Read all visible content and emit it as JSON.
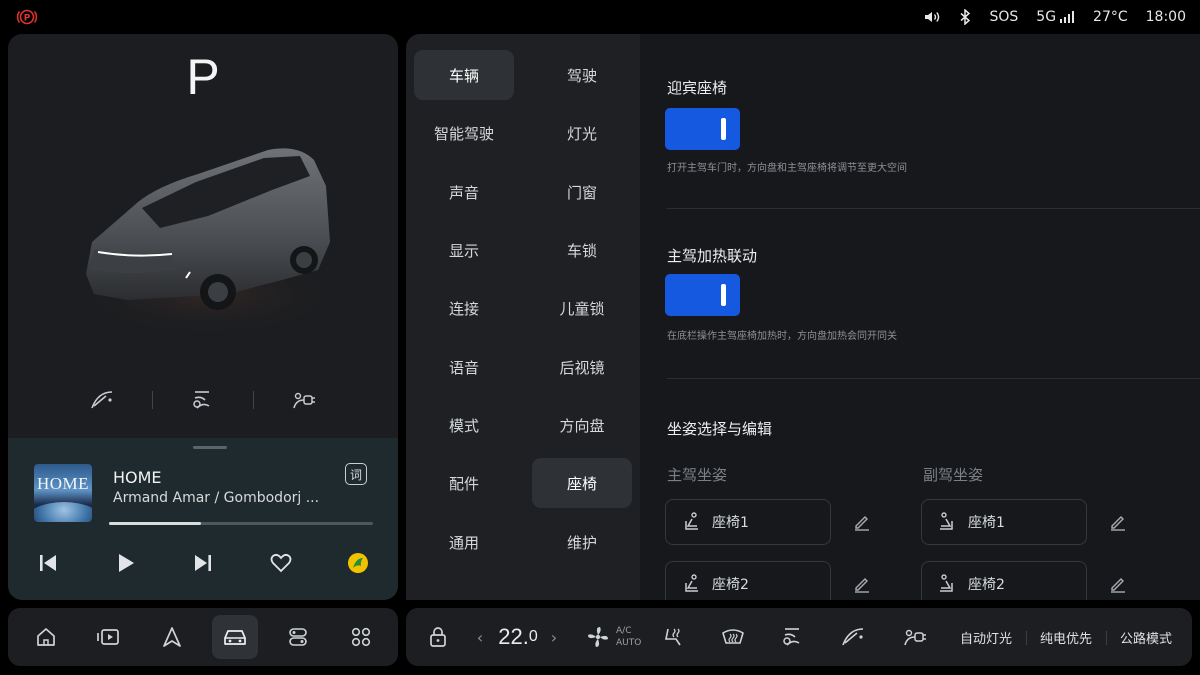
{
  "status_bar": {
    "parking_brake_icon": "parking-brake-icon",
    "volume_icon": "volume-icon",
    "bluetooth_icon": "bluetooth-icon",
    "sos": "SOS",
    "network": "5G",
    "temperature": "27°C",
    "time": "18:00"
  },
  "vehicle": {
    "gear": "P",
    "quick_controls": [
      "wiper-icon",
      "seat-icon",
      "charge-port-icon"
    ]
  },
  "media": {
    "album_art_text": "HOME",
    "title": "HOME",
    "artist": "Armand Amar / Gombodorj ...",
    "lyrics_label": "词",
    "progress": 0.35,
    "controls": [
      "previous-icon",
      "play-icon",
      "next-icon",
      "favorite-icon",
      "music-app-icon"
    ]
  },
  "bottom_nav": {
    "items": [
      "home-icon",
      "media-icon",
      "navigation-icon",
      "car-icon",
      "apps-switch-icon",
      "app-grid-icon"
    ],
    "active_index": 3
  },
  "settings_menu": {
    "active": "座椅",
    "items": [
      {
        "label": "车辆"
      },
      {
        "label": "驾驶"
      },
      {
        "label": "智能驾驶"
      },
      {
        "label": "灯光"
      },
      {
        "label": "声音"
      },
      {
        "label": "门窗"
      },
      {
        "label": "显示"
      },
      {
        "label": "车锁"
      },
      {
        "label": "连接"
      },
      {
        "label": "儿童锁"
      },
      {
        "label": "语音"
      },
      {
        "label": "后视镜"
      },
      {
        "label": "模式"
      },
      {
        "label": "方向盘"
      },
      {
        "label": "配件"
      },
      {
        "label": "座椅"
      },
      {
        "label": "通用"
      },
      {
        "label": "维护"
      }
    ]
  },
  "seat_settings": {
    "welcome_seat": {
      "title": "迎宾座椅",
      "enabled": true,
      "description": "打开主驾车门时，方向盘和主驾座椅将调节至更大空间"
    },
    "heating_link": {
      "title": "主驾加热联动",
      "enabled": true,
      "description": "在底栏操作主驾座椅加热时，方向盘加热会同开同关"
    },
    "posture": {
      "title": "坐姿选择与编辑",
      "driver_label": "主驾坐姿",
      "passenger_label": "副驾坐姿",
      "driver_presets": [
        "座椅1",
        "座椅2"
      ],
      "passenger_presets": [
        "座椅1",
        "座椅2"
      ]
    }
  },
  "climate_bar": {
    "lock_icon": "lock-icon",
    "temperature_main": "22.",
    "temperature_decimal": "0",
    "left_arrow": "‹",
    "right_arrow": "›",
    "ac_line1": "A/C",
    "ac_line2": "AUTO",
    "icons": [
      "fan-icon",
      "seat-heat-icon",
      "defrost-icon",
      "seat-icon",
      "wiper-icon",
      "charge-port-icon"
    ],
    "modes": [
      "自动灯光",
      "纯电优先",
      "公路模式"
    ]
  },
  "colors": {
    "accent": "#1559e0",
    "parking_red": "#e0332d",
    "music_app": "#f2c200"
  }
}
